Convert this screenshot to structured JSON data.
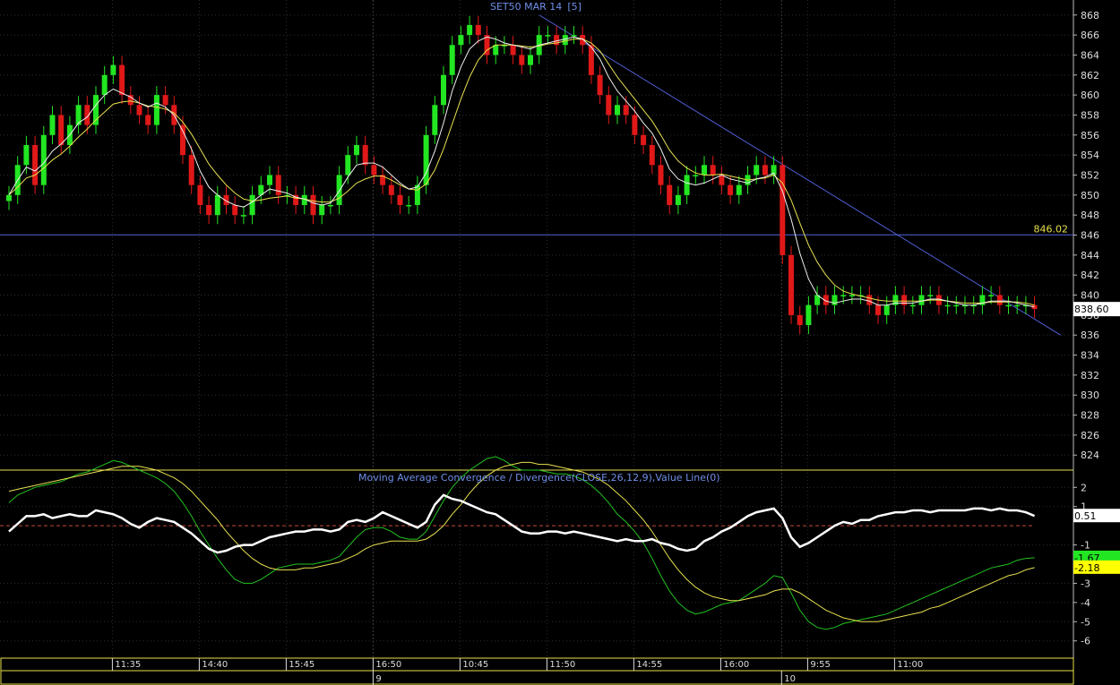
{
  "chart_data": [
    {
      "type": "candlestick",
      "title": "SET50 MAR 14",
      "title_suffix": "[5]",
      "ylim": [
        822.5,
        869.5
      ],
      "y_ticks": [
        824,
        826,
        828,
        830,
        832,
        834,
        836,
        838,
        840,
        842,
        844,
        846,
        848,
        850,
        852,
        854,
        856,
        858,
        860,
        862,
        864,
        866,
        868
      ],
      "horizontal_line": {
        "value": 846.02,
        "label": "846.02"
      },
      "last_price": {
        "value": 838.6,
        "label": "838.60"
      },
      "trendline": {
        "from": {
          "index": 61,
          "value": 868
        },
        "to": {
          "index": 121,
          "value": 836
        }
      },
      "x_time_labels": [
        {
          "index": 12,
          "label": "11:35"
        },
        {
          "index": 22,
          "label": "14:40"
        },
        {
          "index": 32,
          "label": "15:45"
        },
        {
          "index": 42,
          "label": "16:50"
        },
        {
          "index": 52,
          "label": "10:45"
        },
        {
          "index": 62,
          "label": "11:50"
        },
        {
          "index": 72,
          "label": "14:55"
        },
        {
          "index": 82,
          "label": "16:00"
        },
        {
          "index": 92,
          "label": "9:55"
        },
        {
          "index": 102,
          "label": "11:00"
        }
      ],
      "x_day_labels": [
        {
          "index": 42,
          "label": "9"
        },
        {
          "index": 89,
          "label": "10"
        }
      ],
      "close": [
        850,
        853,
        855,
        851,
        856,
        858,
        855,
        857,
        859,
        857,
        860,
        862,
        863,
        860,
        859,
        858,
        857,
        860,
        859,
        857,
        854,
        851,
        849,
        848,
        850,
        849,
        848,
        848,
        850,
        851,
        852,
        850,
        850,
        849,
        850,
        848,
        849,
        849,
        852,
        854,
        855,
        853,
        852,
        851,
        850,
        849,
        849,
        851,
        856,
        859,
        862,
        865,
        866,
        867,
        866,
        864,
        865,
        865,
        864,
        863,
        864,
        866,
        866,
        865,
        866,
        866,
        865,
        862,
        860,
        858,
        859,
        858,
        856,
        855,
        853,
        851,
        849,
        850,
        852,
        852,
        853,
        852,
        851,
        850,
        851,
        852,
        853,
        852,
        853,
        844,
        838,
        837,
        839,
        840,
        839,
        840,
        840,
        840,
        840,
        839,
        838,
        839,
        840,
        839,
        839,
        840,
        840,
        839,
        839,
        839,
        839,
        839,
        840,
        840,
        839,
        839,
        839,
        839,
        838.6
      ],
      "ma_fast": [
        850,
        851.5,
        852.8,
        852.4,
        853.2,
        854.4,
        855.1,
        856,
        857.2,
        857.8,
        859,
        860,
        860.6,
        860.2,
        859.8,
        859.2,
        858.8,
        859.2,
        858.8,
        858,
        856.4,
        854.6,
        852.4,
        850.8,
        850,
        849.4,
        849,
        848.8,
        849.3,
        850,
        850.6,
        850.4,
        850.2,
        849.8,
        849.6,
        849.2,
        849,
        849.2,
        850.4,
        851.8,
        853,
        853.2,
        853.2,
        852.8,
        852,
        851.2,
        850.6,
        850.8,
        852.2,
        854.4,
        857.2,
        860.4,
        862.8,
        864.6,
        865.4,
        865.8,
        865.6,
        865.2,
        865,
        864.8,
        864.6,
        865,
        865.2,
        865.4,
        865.6,
        865.8,
        865.6,
        864.8,
        863.6,
        861.8,
        860.4,
        859.4,
        858.4,
        857.2,
        856.2,
        854.6,
        852.6,
        851.6,
        851.2,
        851,
        851.2,
        851.6,
        852,
        851.6,
        851.4,
        851.2,
        851.6,
        851.8,
        852.2,
        850.4,
        847.6,
        844.2,
        841.6,
        840,
        839.4,
        839.2,
        839.4,
        839.6,
        839.6,
        839.4,
        839,
        839,
        839.2,
        839.2,
        839.2,
        839.4,
        839.6,
        839.6,
        839.4,
        839.2,
        839,
        839,
        839.2,
        839.4,
        839.4,
        839.4,
        839.2,
        839,
        838.8
      ],
      "ma_slow": [
        850,
        850.8,
        851.7,
        852,
        852.7,
        853.5,
        854.1,
        854.9,
        855.8,
        856.6,
        857.5,
        858.3,
        859.1,
        859.3,
        859.4,
        859.2,
        858.9,
        858.8,
        858.6,
        858.2,
        857.3,
        856.1,
        854.6,
        853.1,
        852,
        851,
        850.2,
        849.6,
        849.4,
        849.5,
        849.7,
        849.8,
        849.9,
        849.7,
        849.6,
        849.4,
        849.3,
        849.3,
        849.7,
        850.4,
        851.2,
        851.6,
        851.9,
        851.9,
        851.5,
        851,
        850.6,
        850.5,
        851.1,
        852.5,
        854.6,
        857.1,
        859.6,
        861.8,
        863.5,
        864.5,
        865,
        865,
        865,
        864.9,
        864.8,
        864.9,
        865.1,
        865.2,
        865.4,
        865.6,
        865.6,
        865.2,
        864.4,
        863.1,
        861.8,
        860.7,
        859.6,
        858.5,
        857.4,
        856,
        854.5,
        853.4,
        852.7,
        852.2,
        852,
        852,
        852.1,
        851.9,
        851.7,
        851.5,
        851.6,
        851.7,
        852,
        851.2,
        849.5,
        847.2,
        845,
        843.3,
        842,
        841,
        840.4,
        840.1,
        839.9,
        839.7,
        839.5,
        839.4,
        839.4,
        839.4,
        839.4,
        839.4,
        839.5,
        839.5,
        839.4,
        839.3,
        839.2,
        839.2,
        839.2,
        839.3,
        839.3,
        839.3,
        839.3,
        839.2,
        839
      ]
    },
    {
      "type": "line",
      "title": "Moving Average Convergence / Divergence(CLOSE,26,12,9),Value Line(0)",
      "ylim": [
        -6.9,
        2.9
      ],
      "y_ticks": [
        2,
        1,
        -1,
        -3,
        -4,
        -5,
        -6
      ],
      "zero_line": 0,
      "value_labels": [
        {
          "series": "Value Line",
          "label": "0.51"
        },
        {
          "series": "MACD",
          "label": "-1.67"
        },
        {
          "series": "Signal",
          "label": "-2.18"
        }
      ],
      "series": [
        {
          "name": "MACD",
          "values": [
            1.2,
            1.6,
            1.8,
            2,
            2.1,
            2.2,
            2.3,
            2.5,
            2.7,
            2.8,
            3,
            3.2,
            3.4,
            3.3,
            3.1,
            2.9,
            2.7,
            2.5,
            2.2,
            1.8,
            1.2,
            0.5,
            -0.3,
            -1,
            -1.7,
            -2.3,
            -2.8,
            -3,
            -3,
            -2.8,
            -2.5,
            -2.2,
            -2.1,
            -2,
            -2,
            -2,
            -1.9,
            -1.8,
            -1.6,
            -1.1,
            -0.6,
            -0.2,
            -0.1,
            -0.1,
            -0.3,
            -0.6,
            -0.7,
            -0.7,
            -0.3,
            0.5,
            1.3,
            2,
            2.5,
            2.9,
            3.2,
            3.5,
            3.6,
            3.4,
            3.1,
            2.9,
            2.9,
            2.9,
            2.8,
            2.7,
            2.7,
            2.6,
            2.4,
            2.1,
            1.7,
            1.2,
            0.6,
            0.2,
            -0.3,
            -0.9,
            -1.7,
            -2.6,
            -3.4,
            -4,
            -4.4,
            -4.6,
            -4.5,
            -4.3,
            -4.1,
            -4,
            -3.9,
            -3.6,
            -3.3,
            -3,
            -2.6,
            -2.7,
            -3.5,
            -4.4,
            -5,
            -5.3,
            -5.4,
            -5.3,
            -5.1,
            -5,
            -4.9,
            -4.8,
            -4.7,
            -4.6,
            -4.4,
            -4.2,
            -4,
            -3.8,
            -3.6,
            -3.4,
            -3.2,
            -3,
            -2.8,
            -2.6,
            -2.4,
            -2.2,
            -2.1,
            -2,
            -1.8,
            -1.7,
            -1.67
          ]
        },
        {
          "name": "Signal",
          "values": [
            1.8,
            1.9,
            2,
            2.1,
            2.2,
            2.3,
            2.4,
            2.5,
            2.6,
            2.7,
            2.8,
            2.9,
            3,
            3.1,
            3.1,
            3.1,
            3,
            2.9,
            2.7,
            2.5,
            2.2,
            1.8,
            1.3,
            0.8,
            0.3,
            -0.3,
            -0.8,
            -1.3,
            -1.7,
            -2,
            -2.2,
            -2.3,
            -2.3,
            -2.3,
            -2.2,
            -2.2,
            -2.1,
            -2,
            -1.9,
            -1.7,
            -1.5,
            -1.2,
            -1,
            -0.9,
            -0.8,
            -0.8,
            -0.8,
            -0.8,
            -0.7,
            -0.4,
            0,
            0.6,
            1.1,
            1.7,
            2.2,
            2.6,
            2.9,
            3.1,
            3.2,
            3.3,
            3.3,
            3.2,
            3.2,
            3.1,
            3,
            2.9,
            2.8,
            2.6,
            2.4,
            2.1,
            1.7,
            1.3,
            0.8,
            0.3,
            -0.3,
            -1,
            -1.7,
            -2.3,
            -2.8,
            -3.2,
            -3.5,
            -3.7,
            -3.8,
            -3.9,
            -3.9,
            -3.8,
            -3.7,
            -3.6,
            -3.4,
            -3.3,
            -3.3,
            -3.5,
            -3.8,
            -4.1,
            -4.4,
            -4.6,
            -4.8,
            -4.9,
            -5,
            -5,
            -5,
            -4.9,
            -4.8,
            -4.7,
            -4.6,
            -4.5,
            -4.3,
            -4.2,
            -4,
            -3.8,
            -3.6,
            -3.4,
            -3.2,
            -3,
            -2.8,
            -2.6,
            -2.5,
            -2.3,
            -2.18
          ]
        },
        {
          "name": "Value Line",
          "values": [
            -0.3,
            0.1,
            0.5,
            0.5,
            0.6,
            0.4,
            0.5,
            0.6,
            0.5,
            0.5,
            0.8,
            0.7,
            0.6,
            0.4,
            0.1,
            -0.1,
            0.2,
            0.4,
            0.3,
            0.2,
            -0.1,
            -0.4,
            -0.8,
            -1.2,
            -1.4,
            -1.3,
            -1.1,
            -1,
            -1,
            -0.8,
            -0.6,
            -0.5,
            -0.4,
            -0.3,
            -0.3,
            -0.2,
            -0.2,
            -0.3,
            -0.2,
            0.2,
            0.3,
            0.2,
            0.4,
            0.7,
            0.5,
            0.3,
            0.1,
            -0.1,
            0.2,
            1.1,
            1.6,
            1.4,
            1.3,
            1.1,
            0.9,
            0.7,
            0.6,
            0.3,
            0,
            -0.3,
            -0.4,
            -0.4,
            -0.3,
            -0.3,
            -0.4,
            -0.3,
            -0.4,
            -0.5,
            -0.6,
            -0.7,
            -0.8,
            -0.7,
            -0.8,
            -0.8,
            -0.7,
            -0.9,
            -1,
            -1.2,
            -1.3,
            -1.2,
            -0.8,
            -0.6,
            -0.3,
            -0.1,
            0.2,
            0.5,
            0.7,
            0.8,
            0.9,
            0.4,
            -0.6,
            -1.1,
            -0.9,
            -0.6,
            -0.3,
            0,
            0.2,
            0.1,
            0.3,
            0.3,
            0.5,
            0.6,
            0.7,
            0.7,
            0.8,
            0.8,
            0.7,
            0.8,
            0.8,
            0.8,
            0.8,
            0.9,
            0.9,
            0.8,
            0.9,
            0.8,
            0.8,
            0.7,
            0.51
          ]
        }
      ]
    }
  ]
}
